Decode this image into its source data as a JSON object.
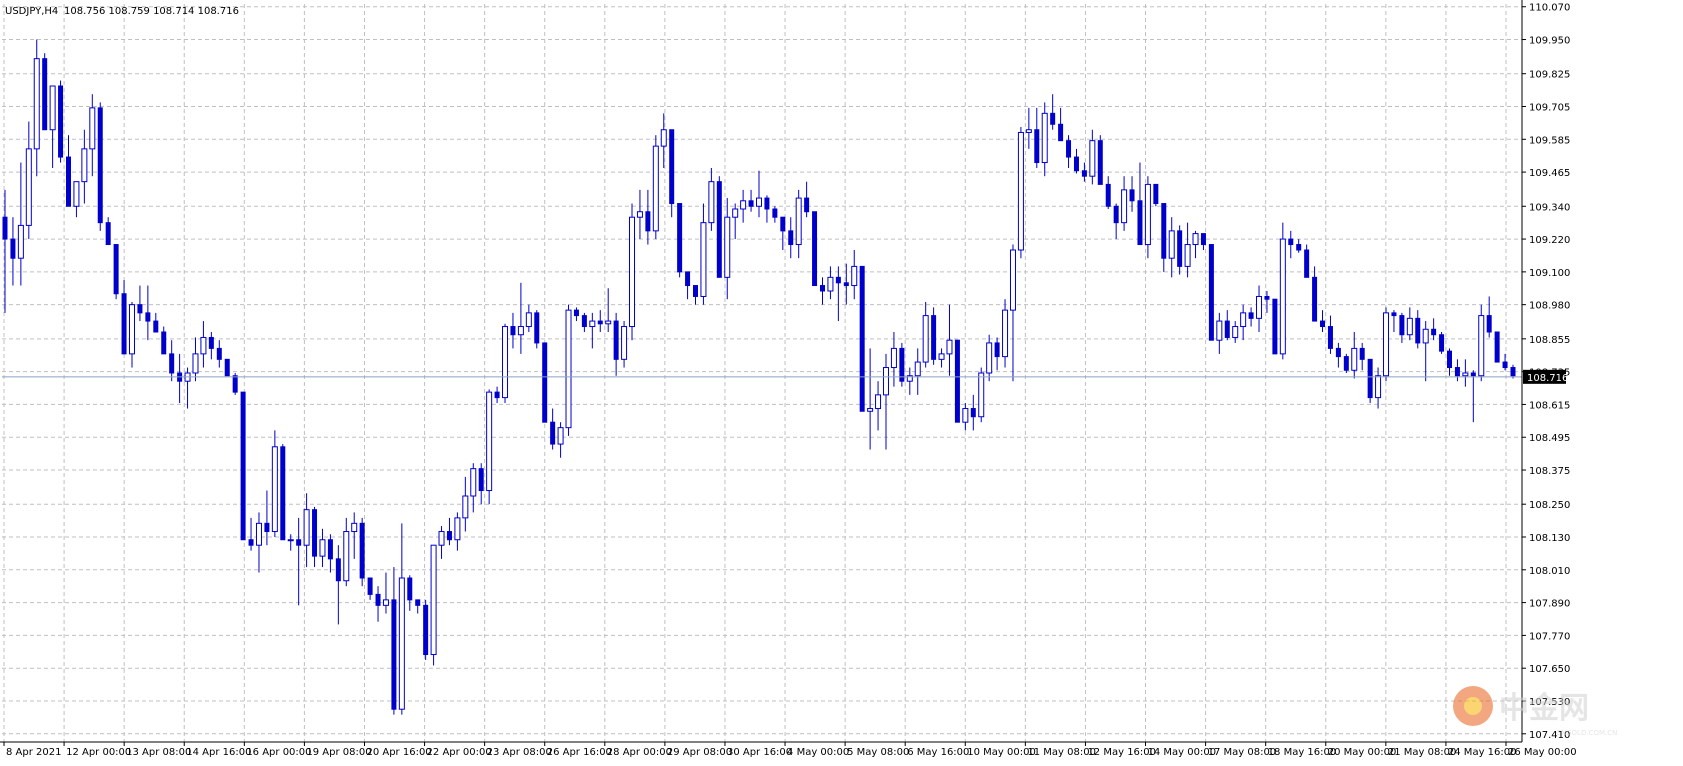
{
  "header": {
    "symbol": "USDJPY,H4",
    "ohlc": "108.756 108.759 108.714 108.716"
  },
  "current_price_label": "108.716",
  "watermark": {
    "brand": "中金网",
    "site": "CNGOLD.COM.CN"
  },
  "colors": {
    "candle": "#0000cc",
    "grid": "#c0c0c0",
    "price_line": "#8aa0c0",
    "label_bg": "#000000",
    "label_text": "#ffffff"
  },
  "chart_data": {
    "type": "candlestick",
    "title": "",
    "xlabel": "",
    "ylabel": "",
    "ylim": [
      107.38,
      110.08
    ],
    "grid": true,
    "y_ticks": [
      "110.070",
      "109.950",
      "109.825",
      "109.705",
      "109.585",
      "109.465",
      "109.340",
      "109.220",
      "109.100",
      "108.980",
      "108.855",
      "108.735",
      "108.615",
      "108.495",
      "108.375",
      "108.250",
      "108.130",
      "108.010",
      "107.890",
      "107.770",
      "107.650",
      "107.530",
      "107.410"
    ],
    "x_labels": [
      "8 Apr 2021",
      "12 Apr 00:00",
      "13 Apr 08:00",
      "14 Apr 16:00",
      "16 Apr 00:00",
      "19 Apr 08:00",
      "20 Apr 16:00",
      "22 Apr 00:00",
      "23 Apr 08:00",
      "26 Apr 16:00",
      "28 Apr 00:00",
      "29 Apr 08:00",
      "30 Apr 16:00",
      "4 May 00:00",
      "5 May 08:00",
      "6 May 16:00",
      "10 May 00:00",
      "11 May 08:00",
      "12 May 16:00",
      "14 May 00:00",
      "17 May 08:00",
      "18 May 16:00",
      "20 May 00:00",
      "21 May 08:00",
      "24 May 16:00",
      "26 May 00:00"
    ],
    "candles": [
      [
        109.3,
        109.4,
        108.95,
        109.22
      ],
      [
        109.22,
        109.3,
        109.05,
        109.15
      ],
      [
        109.15,
        109.5,
        109.05,
        109.27
      ],
      [
        109.27,
        109.65,
        109.22,
        109.55
      ],
      [
        109.55,
        109.95,
        109.45,
        109.88
      ],
      [
        109.88,
        109.9,
        109.7,
        109.62
      ],
      [
        109.62,
        109.78,
        109.48,
        109.78
      ],
      [
        109.78,
        109.8,
        109.5,
        109.52
      ],
      [
        109.52,
        109.6,
        109.4,
        109.34
      ],
      [
        109.34,
        109.43,
        109.3,
        109.43
      ],
      [
        109.43,
        109.62,
        109.35,
        109.55
      ],
      [
        109.55,
        109.75,
        109.45,
        109.7
      ],
      [
        109.7,
        109.72,
        109.25,
        109.28
      ],
      [
        109.28,
        109.3,
        109.2,
        109.2
      ],
      [
        109.2,
        109.2,
        109.0,
        109.02
      ],
      [
        109.02,
        109.07,
        108.98,
        108.8
      ],
      [
        108.8,
        108.99,
        108.75,
        108.98
      ],
      [
        108.98,
        109.05,
        108.92,
        108.95
      ],
      [
        108.95,
        109.05,
        108.85,
        108.92
      ],
      [
        108.92,
        108.95,
        108.9,
        108.88
      ],
      [
        108.88,
        108.9,
        108.8,
        108.8
      ],
      [
        108.8,
        108.85,
        108.7,
        108.73
      ],
      [
        108.73,
        108.8,
        108.62,
        108.7
      ],
      [
        108.7,
        108.75,
        108.6,
        108.73
      ],
      [
        108.73,
        108.86,
        108.7,
        108.8
      ],
      [
        108.8,
        108.92,
        108.75,
        108.86
      ],
      [
        108.86,
        108.88,
        108.78,
        108.82
      ],
      [
        108.82,
        108.85,
        108.75,
        108.78
      ],
      [
        108.78,
        108.78,
        108.72,
        108.72
      ],
      [
        108.72,
        108.73,
        108.65,
        108.66
      ],
      [
        108.66,
        108.66,
        108.12,
        108.12
      ],
      [
        108.12,
        108.2,
        108.08,
        108.1
      ],
      [
        108.1,
        108.22,
        108.0,
        108.18
      ],
      [
        108.18,
        108.3,
        108.1,
        108.15
      ],
      [
        108.15,
        108.52,
        108.13,
        108.46
      ],
      [
        108.46,
        108.47,
        108.12,
        108.12
      ],
      [
        108.12,
        108.14,
        108.08,
        108.12
      ],
      [
        108.12,
        108.2,
        107.88,
        108.1
      ],
      [
        108.1,
        108.29,
        108.02,
        108.23
      ],
      [
        108.23,
        108.24,
        108.02,
        108.06
      ],
      [
        108.06,
        108.16,
        108.02,
        108.12
      ],
      [
        108.12,
        108.14,
        108.0,
        108.05
      ],
      [
        108.05,
        108.1,
        107.81,
        107.97
      ],
      [
        107.97,
        108.2,
        107.95,
        108.15
      ],
      [
        108.15,
        108.22,
        108.05,
        108.18
      ],
      [
        108.18,
        108.2,
        107.95,
        107.98
      ],
      [
        107.98,
        107.98,
        107.9,
        107.92
      ],
      [
        107.92,
        107.95,
        107.82,
        107.88
      ],
      [
        107.88,
        108.0,
        107.85,
        107.9
      ],
      [
        107.9,
        108.02,
        107.48,
        107.5
      ],
      [
        107.5,
        108.18,
        107.48,
        107.98
      ],
      [
        107.98,
        107.99,
        107.86,
        107.9
      ],
      [
        107.9,
        107.9,
        107.85,
        107.88
      ],
      [
        107.88,
        107.9,
        107.68,
        107.7
      ],
      [
        107.7,
        108.1,
        107.66,
        108.1
      ],
      [
        108.1,
        108.17,
        108.05,
        108.15
      ],
      [
        108.15,
        108.2,
        108.1,
        108.12
      ],
      [
        108.12,
        108.22,
        108.08,
        108.2
      ],
      [
        108.2,
        108.35,
        108.15,
        108.28
      ],
      [
        108.28,
        108.4,
        108.22,
        108.38
      ],
      [
        108.38,
        108.4,
        108.25,
        108.3
      ],
      [
        108.3,
        108.67,
        108.25,
        108.66
      ],
      [
        108.66,
        108.68,
        108.62,
        108.64
      ],
      [
        108.64,
        108.91,
        108.62,
        108.9
      ],
      [
        108.9,
        108.95,
        108.82,
        108.87
      ],
      [
        108.87,
        109.06,
        108.8,
        108.9
      ],
      [
        108.9,
        108.98,
        108.88,
        108.95
      ],
      [
        108.95,
        108.96,
        108.82,
        108.84
      ],
      [
        108.84,
        108.84,
        108.55,
        108.55
      ],
      [
        108.55,
        108.6,
        108.45,
        108.47
      ],
      [
        108.47,
        108.55,
        108.42,
        108.53
      ],
      [
        108.53,
        108.98,
        108.5,
        108.96
      ],
      [
        108.96,
        108.97,
        108.92,
        108.94
      ],
      [
        108.94,
        108.95,
        108.88,
        108.9
      ],
      [
        108.9,
        108.95,
        108.82,
        108.92
      ],
      [
        108.92,
        108.96,
        108.88,
        108.91
      ],
      [
        108.91,
        109.04,
        108.88,
        108.92
      ],
      [
        108.92,
        108.95,
        108.72,
        108.78
      ],
      [
        108.78,
        108.92,
        108.75,
        108.9
      ],
      [
        108.9,
        109.35,
        108.85,
        109.3
      ],
      [
        109.3,
        109.4,
        109.22,
        109.32
      ],
      [
        109.32,
        109.4,
        109.2,
        109.25
      ],
      [
        109.25,
        109.6,
        109.22,
        109.56
      ],
      [
        109.56,
        109.68,
        109.48,
        109.62
      ],
      [
        109.62,
        109.62,
        109.3,
        109.35
      ],
      [
        109.35,
        109.35,
        109.08,
        109.1
      ],
      [
        109.1,
        109.1,
        109.0,
        109.05
      ],
      [
        109.05,
        109.05,
        108.98,
        109.01
      ],
      [
        109.01,
        109.35,
        108.98,
        109.28
      ],
      [
        109.28,
        109.48,
        109.25,
        109.43
      ],
      [
        109.43,
        109.45,
        109.08,
        109.08
      ],
      [
        109.08,
        109.37,
        109.0,
        109.3
      ],
      [
        109.3,
        109.35,
        109.22,
        109.33
      ],
      [
        109.33,
        109.4,
        109.28,
        109.36
      ],
      [
        109.36,
        109.4,
        109.32,
        109.34
      ],
      [
        109.34,
        109.47,
        109.3,
        109.37
      ],
      [
        109.37,
        109.38,
        109.28,
        109.33
      ],
      [
        109.33,
        109.34,
        109.28,
        109.3
      ],
      [
        109.3,
        109.3,
        109.18,
        109.25
      ],
      [
        109.25,
        109.3,
        109.15,
        109.2
      ],
      [
        109.2,
        109.4,
        109.15,
        109.37
      ],
      [
        109.37,
        109.43,
        109.3,
        109.32
      ],
      [
        109.32,
        109.32,
        109.05,
        109.05
      ],
      [
        109.05,
        109.08,
        108.98,
        109.03
      ],
      [
        109.03,
        109.12,
        109.0,
        109.08
      ],
      [
        109.08,
        109.12,
        108.92,
        109.06
      ],
      [
        109.06,
        109.13,
        108.98,
        109.05
      ],
      [
        109.05,
        109.18,
        109.0,
        109.12
      ],
      [
        109.12,
        109.12,
        108.59,
        108.59
      ],
      [
        108.59,
        108.82,
        108.45,
        108.6
      ],
      [
        108.6,
        108.7,
        108.52,
        108.65
      ],
      [
        108.65,
        108.8,
        108.45,
        108.75
      ],
      [
        108.75,
        108.88,
        108.68,
        108.82
      ],
      [
        108.82,
        108.84,
        108.68,
        108.7
      ],
      [
        108.7,
        108.75,
        108.65,
        108.72
      ],
      [
        108.72,
        108.82,
        108.65,
        108.77
      ],
      [
        108.77,
        108.99,
        108.75,
        108.94
      ],
      [
        108.94,
        108.97,
        108.76,
        108.78
      ],
      [
        108.78,
        108.82,
        108.75,
        108.8
      ],
      [
        108.8,
        108.98,
        108.72,
        108.85
      ],
      [
        108.85,
        108.85,
        108.55,
        108.55
      ],
      [
        108.55,
        108.62,
        108.52,
        108.6
      ],
      [
        108.6,
        108.65,
        108.52,
        108.57
      ],
      [
        108.57,
        108.75,
        108.55,
        108.73
      ],
      [
        108.73,
        108.87,
        108.7,
        108.84
      ],
      [
        108.84,
        108.86,
        108.74,
        108.79
      ],
      [
        108.79,
        109.0,
        108.75,
        108.96
      ],
      [
        108.96,
        109.2,
        108.7,
        109.18
      ],
      [
        109.18,
        109.63,
        109.15,
        109.61
      ],
      [
        109.61,
        109.7,
        109.55,
        109.62
      ],
      [
        109.62,
        109.7,
        109.48,
        109.5
      ],
      [
        109.5,
        109.72,
        109.45,
        109.68
      ],
      [
        109.68,
        109.75,
        109.62,
        109.64
      ],
      [
        109.64,
        109.7,
        109.58,
        109.58
      ],
      [
        109.58,
        109.6,
        109.48,
        109.52
      ],
      [
        109.52,
        109.55,
        109.46,
        109.47
      ],
      [
        109.47,
        109.5,
        109.43,
        109.45
      ],
      [
        109.45,
        109.62,
        109.42,
        109.58
      ],
      [
        109.58,
        109.6,
        109.42,
        109.42
      ],
      [
        109.42,
        109.45,
        109.33,
        109.34
      ],
      [
        109.34,
        109.35,
        109.22,
        109.28
      ],
      [
        109.28,
        109.45,
        109.25,
        109.4
      ],
      [
        109.4,
        109.45,
        109.32,
        109.36
      ],
      [
        109.36,
        109.5,
        109.3,
        109.2
      ],
      [
        109.2,
        109.45,
        109.15,
        109.42
      ],
      [
        109.42,
        109.42,
        109.34,
        109.35
      ],
      [
        109.35,
        109.35,
        109.1,
        109.15
      ],
      [
        109.15,
        109.3,
        109.08,
        109.25
      ],
      [
        109.25,
        109.27,
        109.09,
        109.12
      ],
      [
        109.12,
        109.28,
        109.08,
        109.2
      ],
      [
        109.2,
        109.25,
        109.15,
        109.24
      ],
      [
        109.24,
        109.24,
        109.18,
        109.2
      ],
      [
        109.2,
        109.2,
        108.85,
        108.85
      ],
      [
        108.85,
        108.95,
        108.8,
        108.92
      ],
      [
        108.92,
        108.96,
        108.85,
        108.86
      ],
      [
        108.86,
        108.92,
        108.84,
        108.9
      ],
      [
        108.9,
        108.98,
        108.85,
        108.95
      ],
      [
        108.95,
        108.97,
        108.9,
        108.93
      ],
      [
        108.93,
        109.05,
        108.88,
        109.01
      ],
      [
        109.01,
        109.03,
        108.95,
        109.0
      ],
      [
        109.0,
        109.0,
        108.8,
        108.8
      ],
      [
        108.8,
        109.28,
        108.78,
        109.22
      ],
      [
        109.22,
        109.25,
        109.15,
        109.2
      ],
      [
        109.2,
        109.22,
        109.17,
        109.18
      ],
      [
        109.18,
        109.2,
        109.08,
        109.08
      ],
      [
        109.08,
        109.12,
        108.92,
        108.92
      ],
      [
        108.92,
        108.96,
        108.88,
        108.9
      ],
      [
        108.9,
        108.94,
        108.8,
        108.82
      ],
      [
        108.82,
        108.84,
        108.75,
        108.79
      ],
      [
        108.79,
        108.8,
        108.73,
        108.74
      ],
      [
        108.74,
        108.88,
        108.71,
        108.82
      ],
      [
        108.82,
        108.84,
        108.74,
        108.78
      ],
      [
        108.78,
        108.78,
        108.62,
        108.64
      ],
      [
        108.64,
        108.75,
        108.6,
        108.72
      ],
      [
        108.72,
        108.97,
        108.7,
        108.95
      ],
      [
        108.95,
        108.96,
        108.88,
        108.94
      ],
      [
        108.94,
        108.95,
        108.84,
        108.87
      ],
      [
        108.87,
        108.97,
        108.85,
        108.93
      ],
      [
        108.93,
        108.96,
        108.82,
        108.84
      ],
      [
        108.84,
        108.92,
        108.7,
        108.89
      ],
      [
        108.89,
        108.93,
        108.85,
        108.87
      ],
      [
        108.87,
        108.88,
        108.8,
        108.81
      ],
      [
        108.81,
        108.82,
        108.72,
        108.75
      ],
      [
        108.75,
        108.78,
        108.7,
        108.72
      ],
      [
        108.72,
        108.78,
        108.68,
        108.73
      ],
      [
        108.73,
        108.74,
        108.55,
        108.72
      ],
      [
        108.72,
        108.98,
        108.7,
        108.94
      ],
      [
        108.94,
        109.01,
        108.86,
        108.88
      ],
      [
        108.88,
        108.88,
        108.77,
        108.77
      ],
      [
        108.77,
        108.8,
        108.74,
        108.75
      ],
      [
        108.75,
        108.76,
        108.71,
        108.72
      ]
    ]
  }
}
